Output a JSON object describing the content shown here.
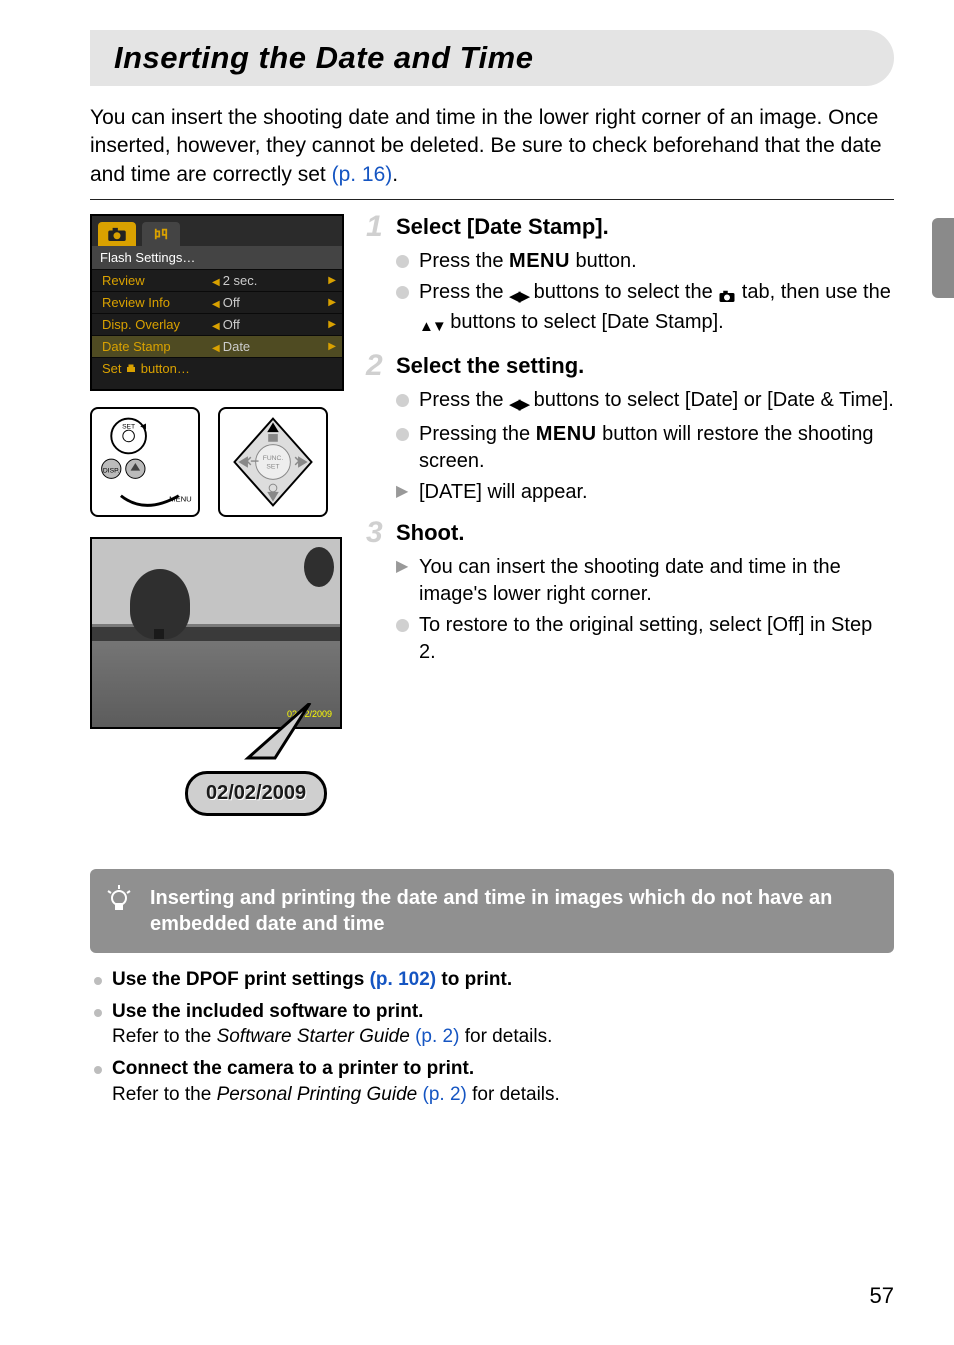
{
  "title": "Inserting the Date and Time",
  "intro_a": "You can insert the shooting date and time in the lower right corner of an image. Once inserted, however, they cannot be deleted. Be sure to check beforehand that the date and time are correctly set ",
  "intro_ref": "(p. 16)",
  "intro_end": ".",
  "menu": {
    "section": "Flash Settings…",
    "rows": [
      {
        "label": "Review",
        "value": "2 sec."
      },
      {
        "label": "Review Info",
        "value": "Off"
      },
      {
        "label": "Disp. Overlay",
        "value": "Off"
      },
      {
        "label": "Date Stamp",
        "value": "Date",
        "highlight": true
      }
    ],
    "last": "Set      button…"
  },
  "date_badge": "02/02/2009",
  "steps": [
    {
      "num": "1",
      "title": "Select [Date Stamp].",
      "bullets": [
        {
          "kind": "dot",
          "parts": [
            {
              "t": "Press the "
            },
            {
              "t": "MENU",
              "cls": "menu-word"
            },
            {
              "t": " button."
            }
          ]
        },
        {
          "kind": "dot",
          "parts": [
            {
              "t": "Press the "
            },
            {
              "icon": "lr"
            },
            {
              "t": " buttons to select the "
            },
            {
              "icon": "cam"
            },
            {
              "t": " tab, then use the "
            },
            {
              "icon": "ud"
            },
            {
              "t": " buttons to select [Date Stamp]."
            }
          ]
        }
      ]
    },
    {
      "num": "2",
      "title": "Select the setting.",
      "bullets": [
        {
          "kind": "dot",
          "parts": [
            {
              "t": "Press the "
            },
            {
              "icon": "lr"
            },
            {
              "t": " buttons to select [Date] or [Date & Time]."
            }
          ]
        },
        {
          "kind": "dot",
          "parts": [
            {
              "t": "Pressing the "
            },
            {
              "t": "MENU",
              "cls": "menu-word"
            },
            {
              "t": " button will restore the shooting screen."
            }
          ]
        },
        {
          "kind": "arrow",
          "parts": [
            {
              "t": "[DATE] will appear."
            }
          ]
        }
      ]
    },
    {
      "num": "3",
      "title": "Shoot.",
      "bullets": [
        {
          "kind": "arrow",
          "parts": [
            {
              "t": "You can insert the shooting date and time in the image's lower right corner."
            }
          ]
        },
        {
          "kind": "dot",
          "parts": [
            {
              "t": "To restore to the original setting, select [Off] in Step 2."
            }
          ]
        }
      ]
    }
  ],
  "tip_title": "Inserting and printing the date and time in images which do not have an embedded date and time",
  "bottom": [
    {
      "bold": "Use the DPOF print settings ",
      "ref": "(p. 102)",
      "after": " to print."
    },
    {
      "bold": "Use the included software to print.",
      "plain_pre": "Refer to the ",
      "ital": "Software Starter Guide",
      "ref": " (p. 2)",
      "plain_post": " for details."
    },
    {
      "bold": "Connect the camera to a printer to print.",
      "plain_pre": "Refer to the ",
      "ital": "Personal Printing Guide",
      "ref": " (p. 2)",
      "plain_post": " for details."
    }
  ],
  "page_num": "57",
  "print_icon_label": "print"
}
